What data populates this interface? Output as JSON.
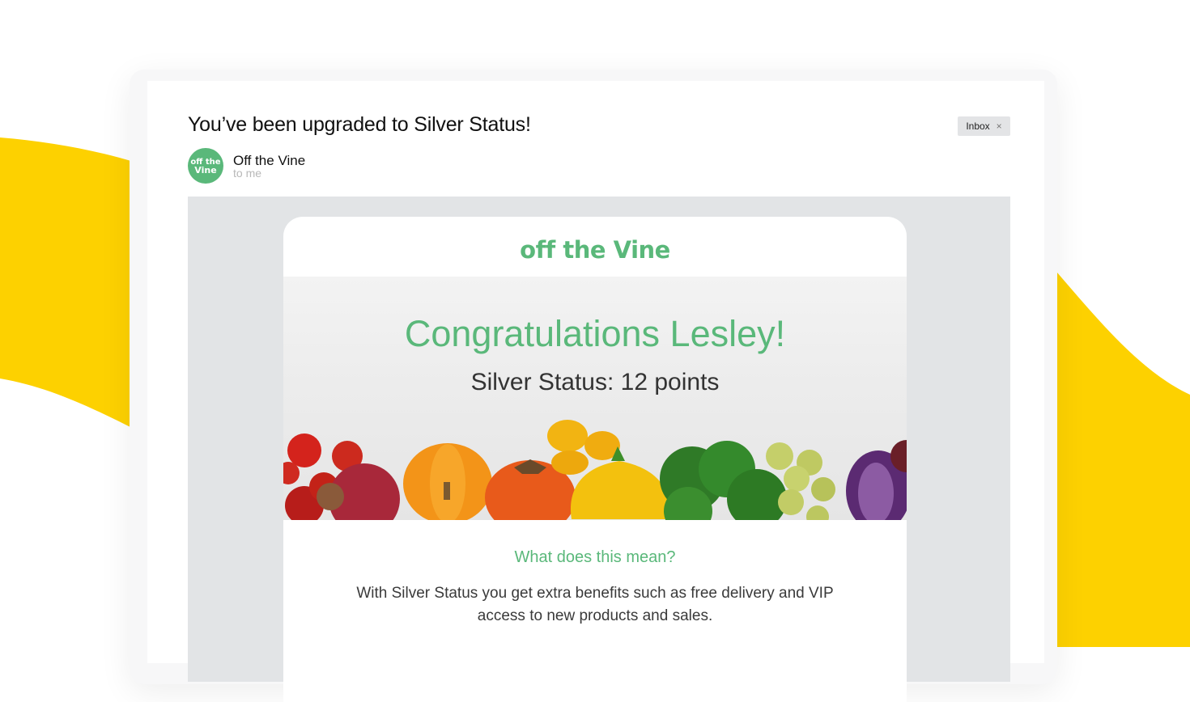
{
  "email": {
    "subject": "You’ve been upgraded to Silver Status!",
    "label": "Inbox",
    "label_close": "×",
    "sender_name": "Off the Vine",
    "recipient": "to me",
    "avatar_text_top": "off the",
    "avatar_text_bottom": "Vine"
  },
  "newsletter": {
    "logo_text": "off the Vine",
    "hero_title": "Congratulations Lesley!",
    "hero_subtitle": "Silver Status: 12 points",
    "section_heading": "What does this mean?",
    "section_body": "With Silver Status you get extra benefits such as free delivery and VIP access to new products and sales."
  },
  "colors": {
    "brand_green": "#5ab87a",
    "accent_yellow": "#fdd100",
    "body_background": "#e2e4e6"
  }
}
